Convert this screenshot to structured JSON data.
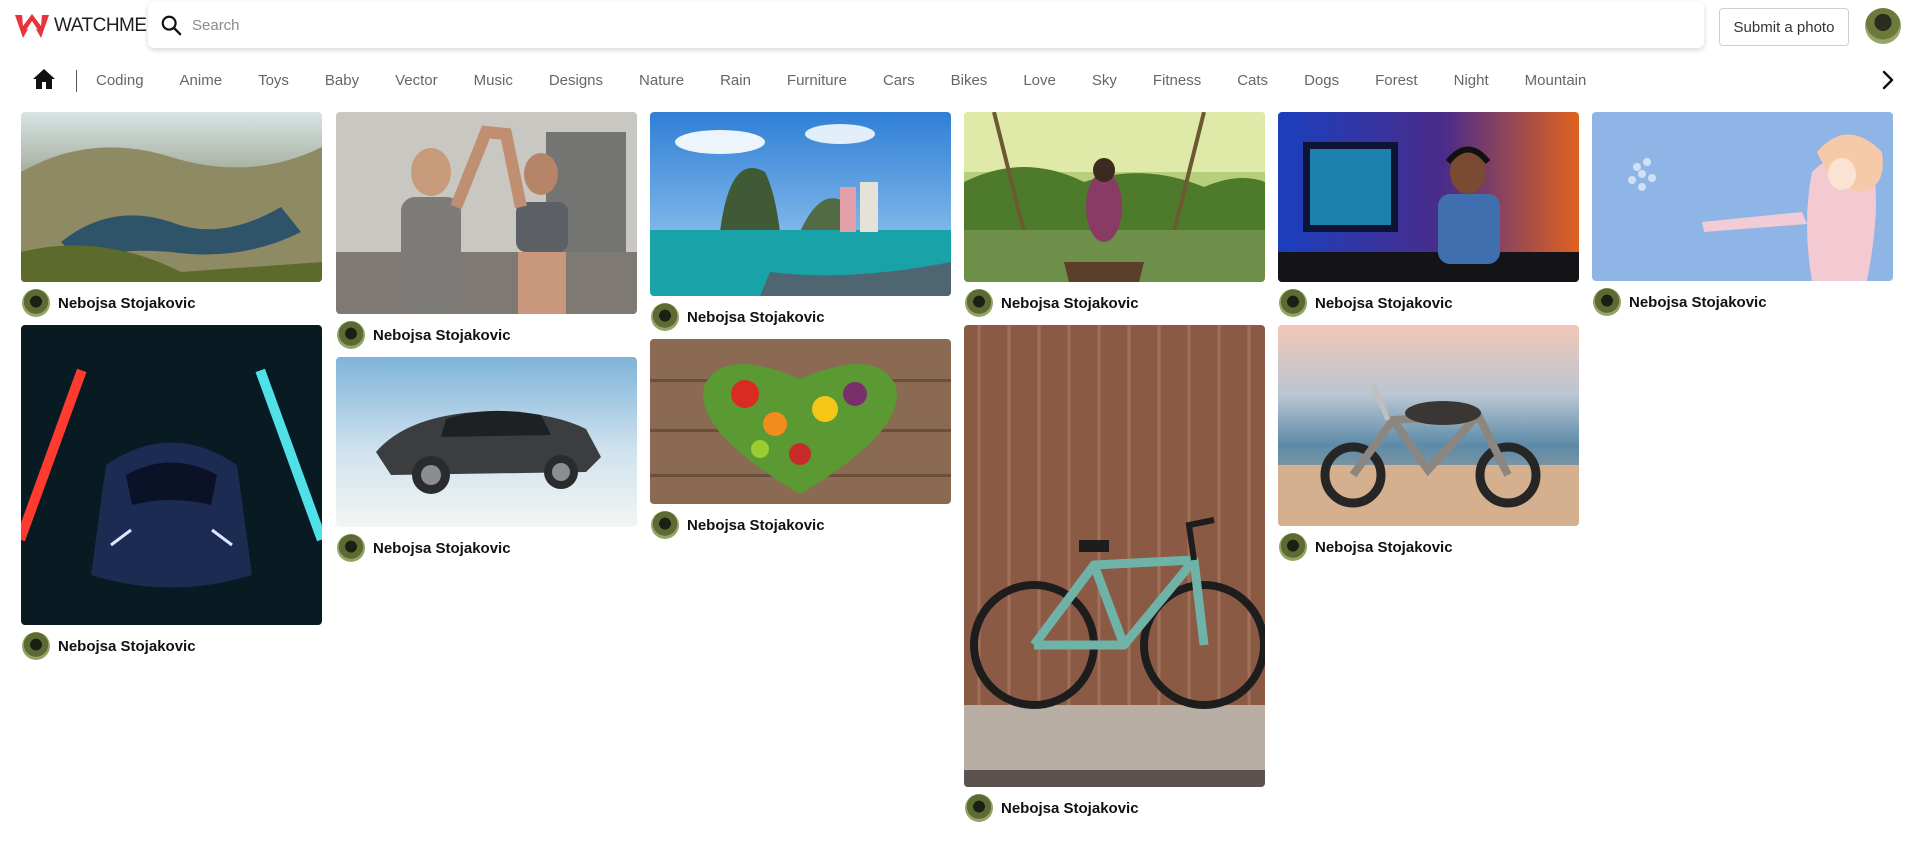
{
  "header": {
    "logo_text": "WATCHME",
    "search_placeholder": "Search",
    "search_value": "",
    "submit_label": "Submit a photo"
  },
  "categories": [
    "Coding",
    "Anime",
    "Toys",
    "Baby",
    "Vector",
    "Music",
    "Designs",
    "Nature",
    "Rain",
    "Furniture",
    "Cars",
    "Bikes",
    "Love",
    "Sky",
    "Fitness",
    "Cats",
    "Dogs",
    "Forest",
    "Night",
    "Mountain"
  ],
  "photos": [
    {
      "author": "Nebojsa Stojakovic",
      "subject": "mountain-lake-landscape"
    },
    {
      "author": "Nebojsa Stojakovic",
      "subject": "gym-high-five"
    },
    {
      "author": "Nebojsa Stojakovic",
      "subject": "tropical-bay-travelers"
    },
    {
      "author": "Nebojsa Stojakovic",
      "subject": "jungle-river-boat"
    },
    {
      "author": "Nebojsa Stojakovic",
      "subject": "gamer-at-desk"
    },
    {
      "author": "Nebojsa Stojakovic",
      "subject": "anime-girl-blue-wall"
    },
    {
      "author": "Nebojsa Stojakovic",
      "subject": "neon-sports-car"
    },
    {
      "author": "Nebojsa Stojakovic",
      "subject": "grey-electric-sedan"
    },
    {
      "author": "Nebojsa Stojakovic",
      "subject": "vegetable-heart"
    },
    {
      "author": "Nebojsa Stojakovic",
      "subject": "gravel-bicycle-rust-wall"
    },
    {
      "author": "Nebojsa Stojakovic",
      "subject": "motorcycle-on-beach"
    }
  ],
  "colors": {
    "brand_red": "#e8333a",
    "text_muted": "#666666"
  },
  "icons": {
    "search": "search-icon",
    "home": "home-icon",
    "next": "chevron-right-icon"
  }
}
